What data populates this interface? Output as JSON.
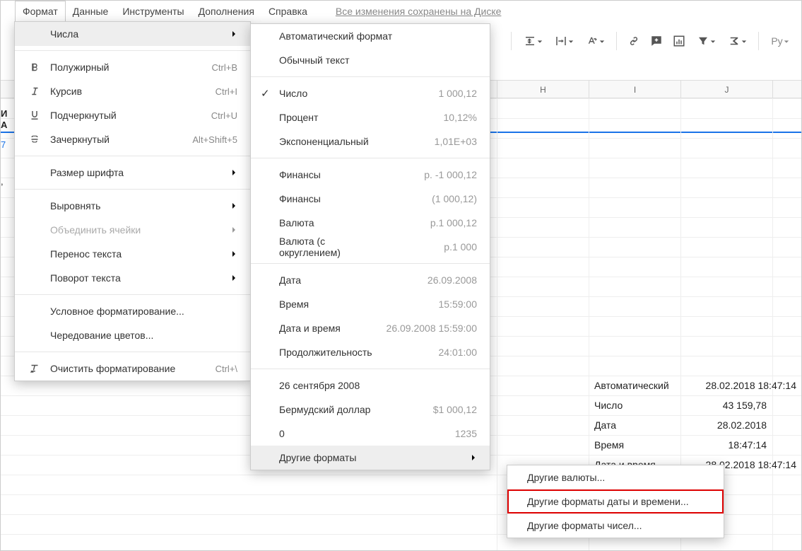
{
  "menubar": {
    "format": "Формат",
    "data": "Данные",
    "tools": "Инструменты",
    "addons": "Дополнения",
    "help": "Справка",
    "saved": "Все изменения сохранены на Диске"
  },
  "leftfrag": {
    "a": "И",
    "b": "А",
    "c": "7"
  },
  "cols": {
    "H": "H",
    "I": "I",
    "J": "J"
  },
  "cells": {
    "h_auto": "Автоматический",
    "j_auto": "28.02.2018 18:47:14",
    "h_num": "Число",
    "j_num": "43 159,78",
    "h_date": "Дата",
    "j_date": "28.02.2018",
    "h_time": "Время",
    "j_time": "18:47:14",
    "h_dt": "Дата и время",
    "j_dt": "28.02.2018 18:47:14"
  },
  "menu1": {
    "numbers": "Числа",
    "bold": "Полужирный",
    "bold_sc": "Ctrl+B",
    "italic": "Курсив",
    "italic_sc": "Ctrl+I",
    "underline": "Подчеркнутый",
    "underline_sc": "Ctrl+U",
    "strike": "Зачеркнутый",
    "strike_sc": "Alt+Shift+5",
    "fontsize": "Размер шрифта",
    "align": "Выровнять",
    "merge": "Объединить ячейки",
    "wrap": "Перенос текста",
    "rotate": "Поворот текста",
    "condfmt": "Условное форматирование...",
    "altcolors": "Чередование цветов...",
    "clear": "Очистить форматирование",
    "clear_sc": "Ctrl+\\"
  },
  "menu2": {
    "auto": "Автоматический формат",
    "plain": "Обычный текст",
    "number": "Число",
    "number_s": "1 000,12",
    "percent": "Процент",
    "percent_s": "10,12%",
    "sci": "Экспоненциальный",
    "sci_s": "1,01E+03",
    "fin1": "Финансы",
    "fin1_s": "р. -1 000,12",
    "fin2": "Финансы",
    "fin2_s": "(1 000,12)",
    "cur1": "Валюта",
    "cur1_s": "р.1 000,12",
    "cur2": "Валюта (с округлением)",
    "cur2_s": "р.1 000",
    "date": "Дата",
    "date_s": "26.09.2008",
    "time": "Время",
    "time_s": "15:59:00",
    "dt": "Дата и время",
    "dt_s": "26.09.2008 15:59:00",
    "dur": "Продолжительность",
    "dur_s": "24:01:00",
    "cust1": "26 сентября 2008",
    "cust2": "Бермудский доллар",
    "cust2_s": "$1 000,12",
    "cust3": "0",
    "cust3_s": "1235",
    "more": "Другие форматы"
  },
  "menu3": {
    "currencies": "Другие валюты...",
    "datetime": "Другие форматы даты и времени...",
    "numbers": "Другие форматы чисел..."
  },
  "toolbar": {
    "lang": "Ру"
  }
}
